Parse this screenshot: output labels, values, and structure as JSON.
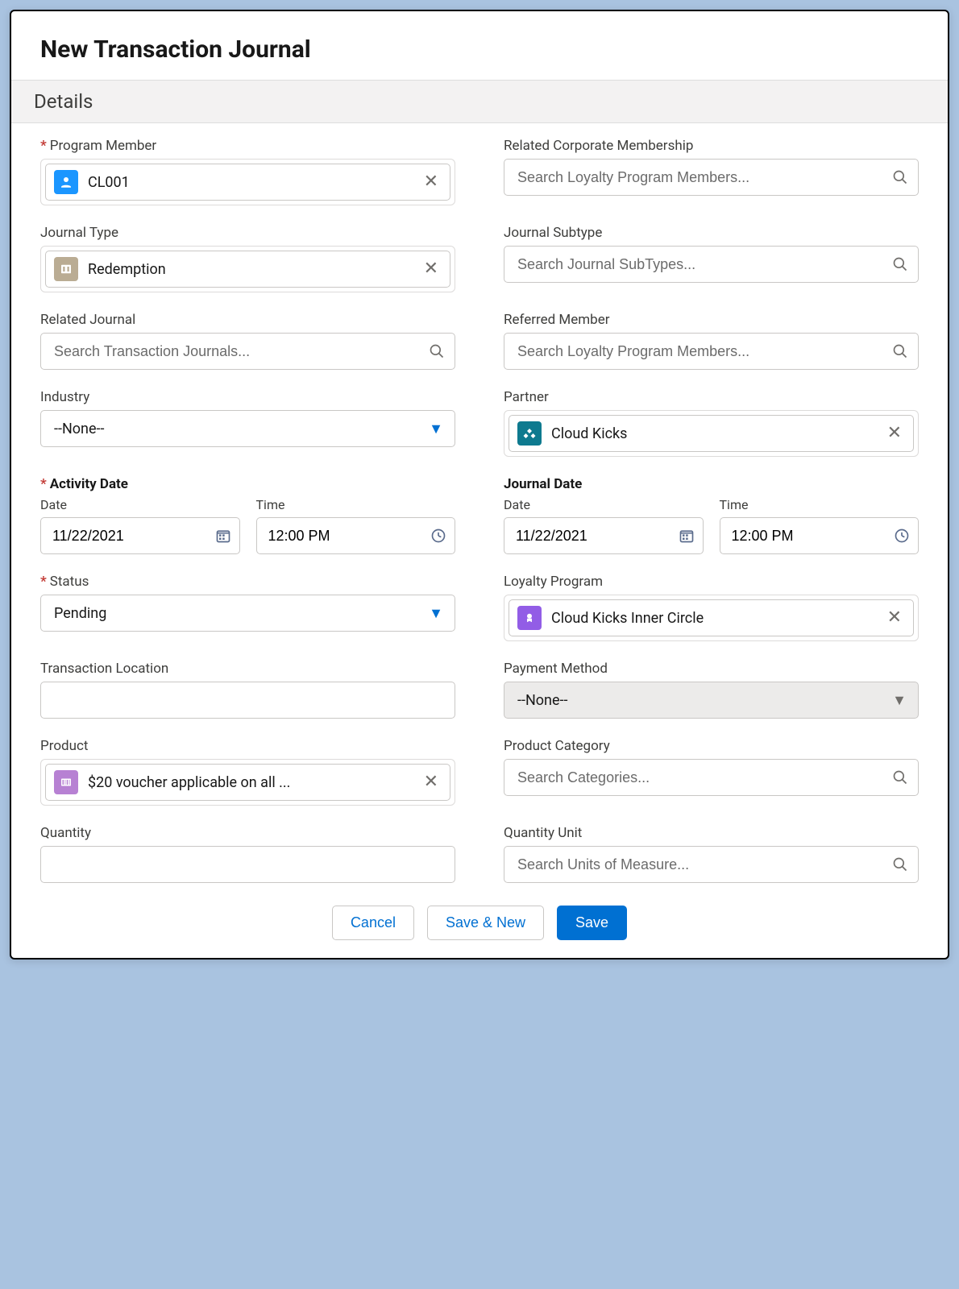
{
  "modal": {
    "title": "New Transaction Journal"
  },
  "section": {
    "details": "Details"
  },
  "fields": {
    "programMember": {
      "label": "Program Member",
      "value": "CL001",
      "iconColor": "#1b96ff"
    },
    "relatedCorpMembership": {
      "label": "Related Corporate Membership",
      "placeholder": "Search Loyalty Program Members..."
    },
    "journalType": {
      "label": "Journal Type",
      "value": "Redemption",
      "iconColor": "#baac93"
    },
    "journalSubtype": {
      "label": "Journal Subtype",
      "placeholder": "Search Journal SubTypes..."
    },
    "relatedJournal": {
      "label": "Related Journal",
      "placeholder": "Search Transaction Journals..."
    },
    "referredMember": {
      "label": "Referred Member",
      "placeholder": "Search Loyalty Program Members..."
    },
    "industry": {
      "label": "Industry",
      "value": "--None--"
    },
    "partner": {
      "label": "Partner",
      "value": "Cloud Kicks",
      "iconColor": "#0e7a8f"
    },
    "activityDate": {
      "label": "Activity Date",
      "dateLabel": "Date",
      "timeLabel": "Time",
      "date": "11/22/2021",
      "time": "12:00 PM"
    },
    "journalDate": {
      "label": "Journal Date",
      "dateLabel": "Date",
      "timeLabel": "Time",
      "date": "11/22/2021",
      "time": "12:00 PM"
    },
    "status": {
      "label": "Status",
      "value": "Pending"
    },
    "loyaltyProgram": {
      "label": "Loyalty Program",
      "value": "Cloud Kicks Inner Circle",
      "iconColor": "#925de6"
    },
    "transactionLocation": {
      "label": "Transaction Location",
      "value": ""
    },
    "paymentMethod": {
      "label": "Payment Method",
      "value": "--None--"
    },
    "product": {
      "label": "Product",
      "value": "$20 voucher applicable on all ...",
      "iconColor": "#b781d3"
    },
    "productCategory": {
      "label": "Product Category",
      "placeholder": "Search Categories..."
    },
    "quantity": {
      "label": "Quantity",
      "value": ""
    },
    "quantityUnit": {
      "label": "Quantity Unit",
      "placeholder": "Search Units of Measure..."
    }
  },
  "buttons": {
    "cancel": "Cancel",
    "saveNew": "Save & New",
    "save": "Save"
  }
}
